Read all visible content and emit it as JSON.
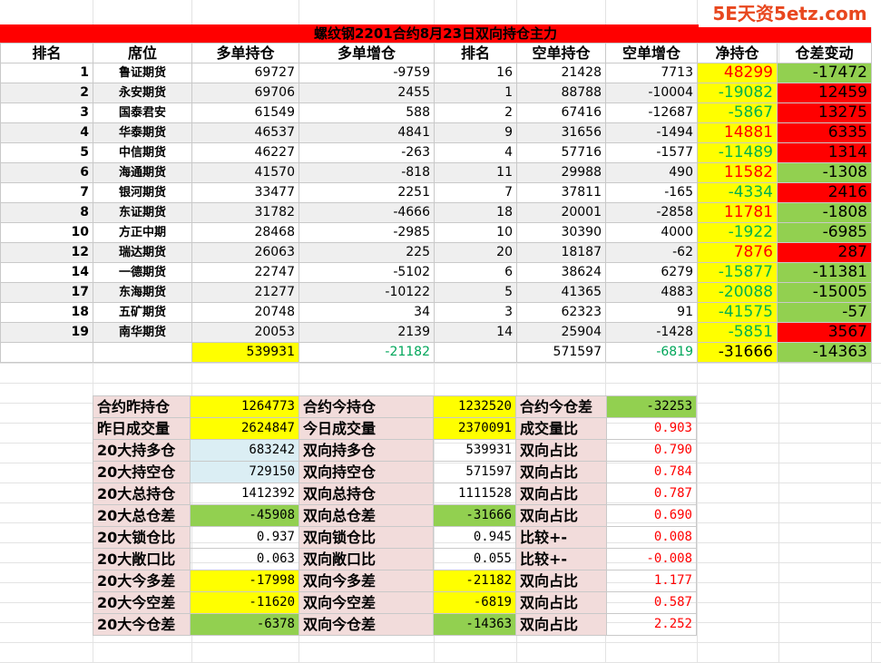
{
  "watermark": "5E天资5etz.com",
  "title": "螺纹钢2201合约8月23日双向持仓主力",
  "headers": [
    "排名",
    "席位",
    "多单持仓",
    "多单增仓",
    "排名",
    "空单持仓",
    "空单增仓",
    "净持仓",
    "仓差变动"
  ],
  "rows": [
    {
      "rank": "1",
      "seat": "鲁证期货",
      "long": "69727",
      "long_chg": "-9759",
      "srank": "16",
      "short": "21428",
      "short_chg": "7713",
      "net": "48299",
      "diff": "-17472"
    },
    {
      "rank": "2",
      "seat": "永安期货",
      "long": "69706",
      "long_chg": "2455",
      "srank": "1",
      "short": "88788",
      "short_chg": "-10004",
      "net": "-19082",
      "diff": "12459"
    },
    {
      "rank": "3",
      "seat": "国泰君安",
      "long": "61549",
      "long_chg": "588",
      "srank": "2",
      "short": "67416",
      "short_chg": "-12687",
      "net": "-5867",
      "diff": "13275"
    },
    {
      "rank": "4",
      "seat": "华泰期货",
      "long": "46537",
      "long_chg": "4841",
      "srank": "9",
      "short": "31656",
      "short_chg": "-1494",
      "net": "14881",
      "diff": "6335"
    },
    {
      "rank": "5",
      "seat": "中信期货",
      "long": "46227",
      "long_chg": "-263",
      "srank": "4",
      "short": "57716",
      "short_chg": "-1577",
      "net": "-11489",
      "diff": "1314"
    },
    {
      "rank": "6",
      "seat": "海通期货",
      "long": "41570",
      "long_chg": "-818",
      "srank": "11",
      "short": "29988",
      "short_chg": "490",
      "net": "11582",
      "diff": "-1308"
    },
    {
      "rank": "7",
      "seat": "银河期货",
      "long": "33477",
      "long_chg": "2251",
      "srank": "7",
      "short": "37811",
      "short_chg": "-165",
      "net": "-4334",
      "diff": "2416"
    },
    {
      "rank": "8",
      "seat": "东证期货",
      "long": "31782",
      "long_chg": "-4666",
      "srank": "18",
      "short": "20001",
      "short_chg": "-2858",
      "net": "11781",
      "diff": "-1808"
    },
    {
      "rank": "10",
      "seat": "方正中期",
      "long": "28468",
      "long_chg": "-2985",
      "srank": "10",
      "short": "30390",
      "short_chg": "4000",
      "net": "-1922",
      "diff": "-6985"
    },
    {
      "rank": "12",
      "seat": "瑞达期货",
      "long": "26063",
      "long_chg": "225",
      "srank": "20",
      "short": "18187",
      "short_chg": "-62",
      "net": "7876",
      "diff": "287"
    },
    {
      "rank": "14",
      "seat": "一德期货",
      "long": "22747",
      "long_chg": "-5102",
      "srank": "6",
      "short": "38624",
      "short_chg": "6279",
      "net": "-15877",
      "diff": "-11381"
    },
    {
      "rank": "17",
      "seat": "东海期货",
      "long": "21277",
      "long_chg": "-10122",
      "srank": "5",
      "short": "41365",
      "short_chg": "4883",
      "net": "-20088",
      "diff": "-15005"
    },
    {
      "rank": "18",
      "seat": "五矿期货",
      "long": "20748",
      "long_chg": "34",
      "srank": "3",
      "short": "62323",
      "short_chg": "91",
      "net": "-41575",
      "diff": "-57"
    },
    {
      "rank": "19",
      "seat": "南华期货",
      "long": "20053",
      "long_chg": "2139",
      "srank": "14",
      "short": "25904",
      "short_chg": "-1428",
      "net": "-5851",
      "diff": "3567"
    }
  ],
  "totals": {
    "long": "539931",
    "long_chg": "-21182",
    "short": "571597",
    "short_chg": "-6819",
    "net": "-31666",
    "diff": "-14363"
  },
  "summary": [
    {
      "l1": "合约昨持仓",
      "v1": "1264773",
      "l2": "合约今持仓",
      "v2": "1232520",
      "l3": "合约今仓差",
      "v3": "-32253"
    },
    {
      "l1": "昨日成交量",
      "v1": "2624847",
      "l2": "今日成交量",
      "v2": "2370091",
      "l3": "成交量比",
      "v3": "0.903"
    },
    {
      "l1": "20大持多仓",
      "v1": "683242",
      "l2": "双向持多仓",
      "v2": "539931",
      "l3": "双向占比",
      "v3": "0.790"
    },
    {
      "l1": "20大持空仓",
      "v1": "729150",
      "l2": "双向持空仓",
      "v2": "571597",
      "l3": "双向占比",
      "v3": "0.784"
    },
    {
      "l1": "20大总持仓",
      "v1": "1412392",
      "l2": "双向总持仓",
      "v2": "1111528",
      "l3": "双向占比",
      "v3": "0.787"
    },
    {
      "l1": "20大总仓差",
      "v1": "-45908",
      "l2": "双向总仓差",
      "v2": "-31666",
      "l3": "双向占比",
      "v3": "0.690"
    },
    {
      "l1": "20大锁仓比",
      "v1": "0.937",
      "l2": "双向锁仓比",
      "v2": "0.945",
      "l3": "比较+-",
      "v3": "0.008"
    },
    {
      "l1": "20大敞口比",
      "v1": "0.063",
      "l2": "双向敞口比",
      "v2": "0.055",
      "l3": "比较+-",
      "v3": "-0.008"
    },
    {
      "l1": "20大今多差",
      "v1": "-17998",
      "l2": "双向今多差",
      "v2": "-21182",
      "l3": "双向占比",
      "v3": "1.177"
    },
    {
      "l1": "20大今空差",
      "v1": "-11620",
      "l2": "双向今空差",
      "v2": "-6819",
      "l3": "双向占比",
      "v3": "0.587"
    },
    {
      "l1": "20大今仓差",
      "v1": "-6378",
      "l2": "双向今仓差",
      "v2": "-14363",
      "l3": "双向占比",
      "v3": "2.252"
    }
  ],
  "colors": {
    "header_bar": "#ff0000",
    "highlight": "#ffff00",
    "positive": "#92d050",
    "negative": "#ff0000",
    "pink": "#f2dcdb",
    "lightblue": "#dbeef4"
  }
}
